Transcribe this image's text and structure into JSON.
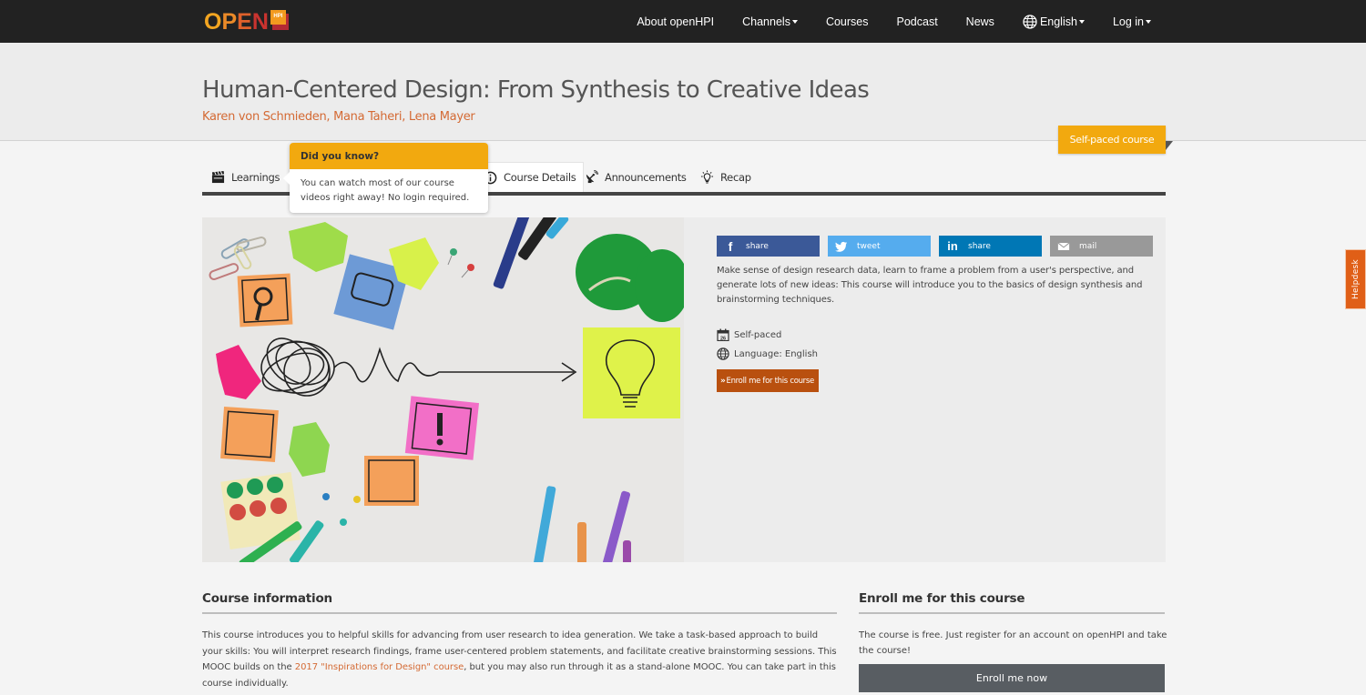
{
  "brand": {
    "logo_text": [
      "O",
      "P",
      "E",
      "N"
    ],
    "logo_badge": "HPI",
    "colors": {
      "dark_bar": "#222222",
      "accent_orange": "#f2a90f",
      "teacher_orange": "#d46a34",
      "enroll_brown": "#b9500f",
      "helpdesk": "#e05f17"
    }
  },
  "nav": {
    "items": [
      {
        "label": "About openHPI",
        "dropdown": false
      },
      {
        "label": "Channels",
        "dropdown": true
      },
      {
        "label": "Courses",
        "dropdown": false
      },
      {
        "label": "Podcast",
        "dropdown": false
      },
      {
        "label": "News",
        "dropdown": false
      },
      {
        "label": "English",
        "dropdown": true,
        "icon": "globe-icon"
      },
      {
        "label": "Log in",
        "dropdown": true
      }
    ]
  },
  "course": {
    "title": "Human-Centered Design: From Synthesis to Creative Ideas",
    "teachers": "Karen von Schmieden, Mana Taheri, Lena Mayer",
    "ribbon": "Self-paced course"
  },
  "tabs": [
    {
      "label": "Learnings",
      "icon": "clapperboard-icon",
      "active": false
    },
    {
      "label": "Course Details",
      "icon": "info-icon",
      "active": true
    },
    {
      "label": "Announcements",
      "icon": "satellite-dish-icon",
      "active": false
    },
    {
      "label": "Recap",
      "icon": "lightbulb-icon",
      "active": false
    }
  ],
  "tooltip": {
    "title": "Did you know?",
    "body": "You can watch most of our course videos right away! No login required."
  },
  "share": [
    {
      "label": "share",
      "network": "facebook",
      "color": "#3b5998"
    },
    {
      "label": "tweet",
      "network": "twitter",
      "color": "#55acee"
    },
    {
      "label": "share",
      "network": "linkedin",
      "color": "#0077b5"
    },
    {
      "label": "mail",
      "network": "email",
      "color": "#999999"
    }
  ],
  "abstract": "Make sense of design research data, learn to frame a problem from a user's perspective, and generate lots of new ideas: This course will introduce you to the basics of design synthesis and brainstorming techniques.",
  "meta": {
    "pace": "Self-paced",
    "calendar_day": "26",
    "language": "Language: English"
  },
  "enroll_button": "Enroll me for this course",
  "helpdesk": "Helpdesk",
  "course_info": {
    "heading": "Course information",
    "text_before_link": "This course introduces you to helpful skills for advancing from user research to idea generation. We take a task-based approach to build your skills: You will interpret research findings, frame user-centered problem statements, and facilitate creative brainstorming sessions. This MOOC builds on the ",
    "link_text": "2017 \"Inspirations for Design\" course",
    "text_after_link": ", but you may also run through it as a stand-alone MOOC. You can take part in this course individually."
  },
  "enroll_section": {
    "heading": "Enroll me for this course",
    "text": "The course is free. Just register for an account on openHPI and take the course!",
    "button": "Enroll me now"
  }
}
